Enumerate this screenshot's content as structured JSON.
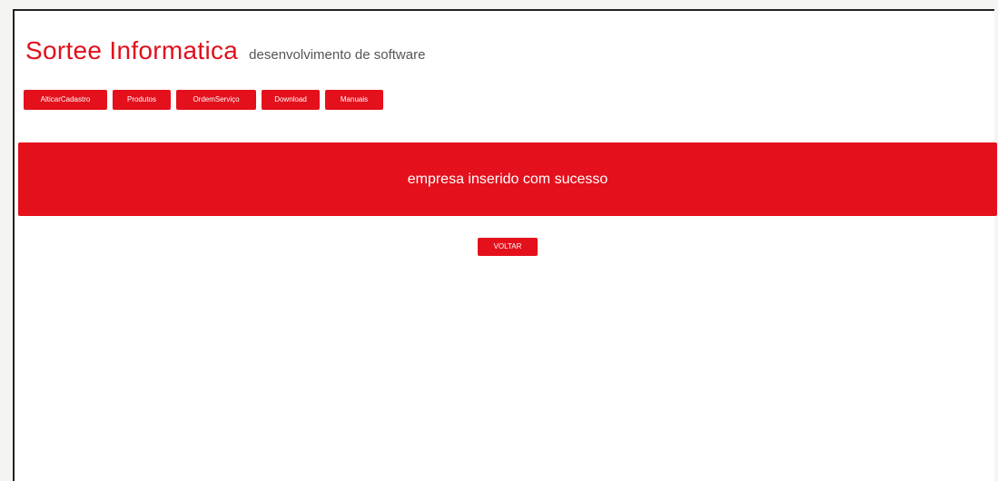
{
  "header": {
    "brand": "Sortee Informatica",
    "tagline": "desenvolvimento de software"
  },
  "nav": {
    "items": [
      {
        "label": "AlticarCadastro"
      },
      {
        "label": "Produtos"
      },
      {
        "label": "OrdemServiço"
      },
      {
        "label": "Download"
      },
      {
        "label": "Manuais"
      }
    ]
  },
  "alert": {
    "message": "empresa inserido com sucesso"
  },
  "actions": {
    "back_label": "VOLTAR"
  },
  "colors": {
    "accent": "#e4101c",
    "brand_text": "#e0101c"
  }
}
